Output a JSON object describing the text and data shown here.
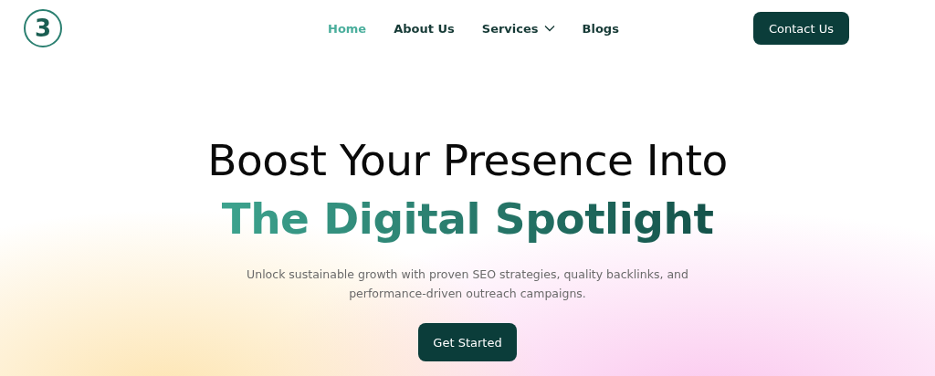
{
  "logo": {
    "mark": "3"
  },
  "nav": [
    {
      "label": "Home",
      "selected": true,
      "dropdown": false
    },
    {
      "label": "About Us",
      "selected": false,
      "dropdown": false
    },
    {
      "label": "Services",
      "selected": false,
      "dropdown": true
    },
    {
      "label": "Blogs",
      "selected": false,
      "dropdown": false
    }
  ],
  "contact_button": "Contact Us",
  "hero": {
    "title_line_1": "Boost Your Presence Into",
    "title_line_2": "The Digital Spotlight",
    "subtitle": "Unlock sustainable growth with proven SEO strategies, quality backlinks, and performance-driven outreach campaigns.",
    "button": "Get Started"
  }
}
